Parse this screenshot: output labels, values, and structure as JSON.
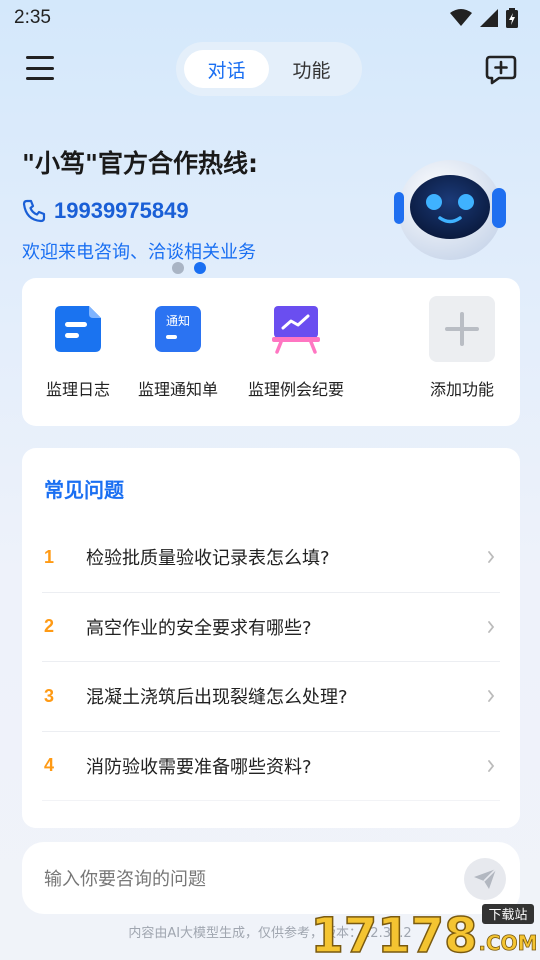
{
  "status_bar": {
    "time": "2:35",
    "icons": [
      "wifi-icon",
      "signal-icon",
      "battery-icon"
    ]
  },
  "header": {
    "tabs": [
      {
        "label": "对话",
        "active": true
      },
      {
        "label": "功能",
        "active": false
      }
    ],
    "menu_icon": "menu-icon",
    "new_chat_icon": "new-chat-icon"
  },
  "banner": {
    "title": "\"小笃\"官方合作热线:",
    "phone": "19939975849",
    "subtitle": "欢迎来电咨询、洽谈相关业务",
    "carousel": {
      "count": 2,
      "active_index": 1
    }
  },
  "features": [
    {
      "label": "监理日志",
      "icon": "log-document-icon"
    },
    {
      "label": "监理通知单",
      "icon": "notice-icon",
      "icon_text": "通知"
    },
    {
      "label": "监理例会纪要",
      "icon": "meeting-board-icon"
    },
    {
      "label": "添加功能",
      "icon": "plus-icon"
    }
  ],
  "faq": {
    "title": "常见问题",
    "items": [
      {
        "num": "1",
        "text": "检验批质量验收记录表怎么填?"
      },
      {
        "num": "2",
        "text": "高空作业的安全要求有哪些?"
      },
      {
        "num": "3",
        "text": "混凝土浇筑后出现裂缝怎么处理?"
      },
      {
        "num": "4",
        "text": "消防验收需要准备哪些资料?"
      }
    ]
  },
  "input": {
    "placeholder": "输入你要咨询的问题",
    "value": ""
  },
  "footer": {
    "note": "内容由AI大模型生成，仅供参考，版本：12.35.2"
  },
  "watermark": {
    "brand": "17178",
    "tag": "下载站",
    "suffix": ".COM"
  },
  "colors": {
    "accent": "#1a6ff2",
    "faq_number": "#ff9a14",
    "text": "#222222"
  }
}
